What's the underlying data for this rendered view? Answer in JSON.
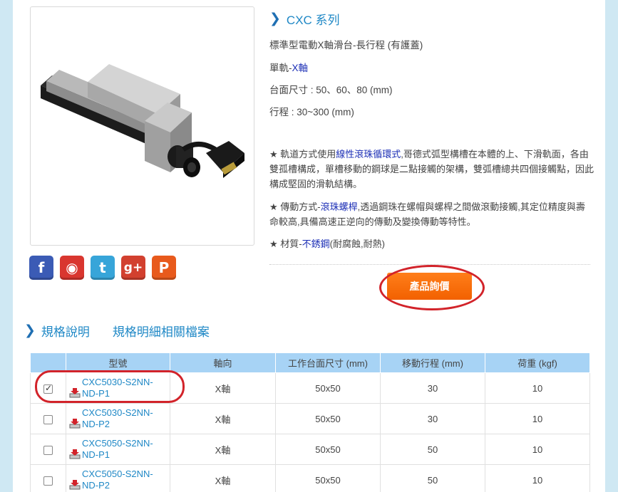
{
  "product": {
    "series_title": "CXC 系列",
    "subtitle": "標準型電動X軸滑台-長行程 (有護蓋)",
    "axis_prefix": "單軌-",
    "axis_value": "X軸",
    "table_size": "台面尺寸 : 50、60、80 (mm)",
    "stroke": "行程 : 30~300 (mm)"
  },
  "features": [
    {
      "prefix": "★ 軌道方式使用",
      "link": "線性滾珠循環式",
      "rest": ",哥德式弧型構槽在本體的上、下滑軌面，各由雙孤槽構成，單槽移動的鋼球是二點接觸的架構，雙弧槽總共四個接觸點，因此構成堅固的滑軌結構。"
    },
    {
      "prefix": "★ 傳動方式-",
      "link": "滾珠螺桿",
      "rest": ",透過鋼珠在螺帽與螺桿之間做滾動接觸,其定位精度與壽命較高,具備高速正逆向的傳動及變換傳動等特性。"
    },
    {
      "prefix": "★ 材質-",
      "link": "不銹鋼",
      "rest": "(耐腐蝕,耐熱)"
    }
  ],
  "inquiry_label": "產品詢價",
  "social": [
    {
      "glyph": "f",
      "color": "#3b5bb5",
      "name": "facebook"
    },
    {
      "glyph": "◉",
      "color": "#d9362f",
      "name": "weibo"
    },
    {
      "glyph": "t",
      "color": "#37a5d9",
      "name": "twitter"
    },
    {
      "glyph": "g+",
      "color": "#d2402f",
      "name": "google-plus"
    },
    {
      "glyph": "P",
      "color": "#e85a1c",
      "name": "plurk"
    }
  ],
  "tabs": {
    "spec": "規格說明",
    "files": "規格明細相關檔案"
  },
  "table": {
    "headers": [
      "",
      "型號",
      "軸向",
      "工作台面尺寸 (mm)",
      "移動行程 (mm)",
      "荷重 (kgf)"
    ],
    "rows": [
      {
        "checked": true,
        "model_line1": "CXC5030-S2NN-",
        "model_line2": "ND-P1",
        "axis": "X軸",
        "size": "50x50",
        "stroke": "30",
        "load": "10"
      },
      {
        "checked": false,
        "model_line1": "CXC5030-S2NN-",
        "model_line2": "ND-P2",
        "axis": "X軸",
        "size": "50x50",
        "stroke": "30",
        "load": "10"
      },
      {
        "checked": false,
        "model_line1": "CXC5050-S2NN-",
        "model_line2": "ND-P1",
        "axis": "X軸",
        "size": "50x50",
        "stroke": "50",
        "load": "10"
      },
      {
        "checked": false,
        "model_line1": "CXC5050-S2NN-",
        "model_line2": "ND-P2",
        "axis": "X軸",
        "size": "50x50",
        "stroke": "50",
        "load": "10"
      }
    ]
  },
  "colors": {
    "accent": "#1f88c6",
    "button": "#f26100",
    "header_bg": "#a7d3f5",
    "annotation": "#d2232a"
  }
}
